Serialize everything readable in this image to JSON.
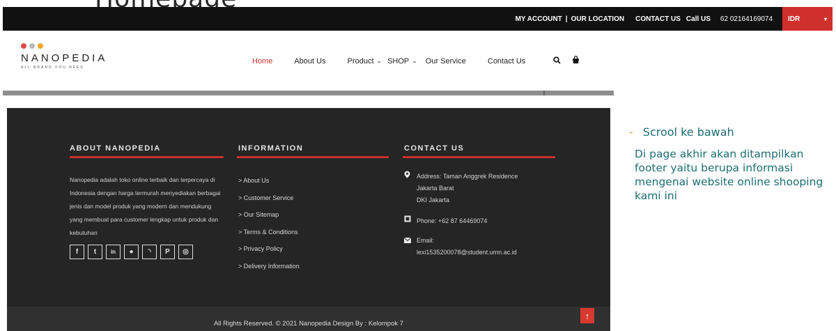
{
  "slide": {
    "title": "Homepage"
  },
  "topbar": {
    "links": [
      "MY ACCOUNT",
      "|",
      "OUR LOCATION",
      "CONTACT US",
      "Call US",
      "62 02164169074"
    ],
    "language": "IDR"
  },
  "brand": {
    "name": "NANOPEDIA",
    "tagline": "ALL BRAND YOU NEED",
    "dot_colors": [
      "#e34b4b",
      "#b9b9b9",
      "#f1a62d"
    ]
  },
  "nav": {
    "items": [
      "Home",
      "About Us",
      "Product",
      "SHOP",
      "Our Service",
      "Contact Us"
    ],
    "dropdown_marks": [
      "⌄",
      "⌄"
    ],
    "active": "Home"
  },
  "footer": {
    "about": {
      "heading": "ABOUT NANOPEDIA",
      "text": "Nanopedia adalah toko online terbaik dan terpercaya di Indonesia dengan harga termurah menyediakan berbagai jenis dan model produk yang modern dan mendukung yang membuat para customer lengkap untuk produk dan kebutuhan"
    },
    "social_icons": [
      "facebook-icon",
      "twitter-icon",
      "linkedin-icon",
      "dribbble-icon",
      "rss-icon",
      "pinterest-icon",
      "instagram-icon"
    ],
    "social_glyphs": [
      "f",
      "t",
      "in",
      "●",
      "◝",
      "P",
      "◎"
    ],
    "information": {
      "heading": "INFORMATION",
      "links": [
        "About Us",
        "Customer Service",
        "Our Sitemap",
        "Terms & Conditions",
        "Privacy Policy",
        "Delivery Information"
      ]
    },
    "contact": {
      "heading": "CONTACT US",
      "address_lines": [
        "Address: Taman Anggrek Residence",
        "Jakarta Barat",
        "DKI Jakarta"
      ],
      "phone": "Phone: +62 87 64469074",
      "email_label": "Email:",
      "email": "lexi1535200078@student.umn.ac.id"
    },
    "copyright": "All Rights Reserved. © 2021 Nanopedia Design By : Kelompok 7",
    "to_top": "↑"
  },
  "side_note": {
    "bullet": "Scrool ke bawah",
    "paragraph": "Di page akhir akan ditampilkan footer yaitu berupa informasi mengenai website online shooping kami ini"
  },
  "colors": {
    "accent_red": "#d0302c",
    "footer_bg": "#252525",
    "note_text": "#1d6e72"
  }
}
